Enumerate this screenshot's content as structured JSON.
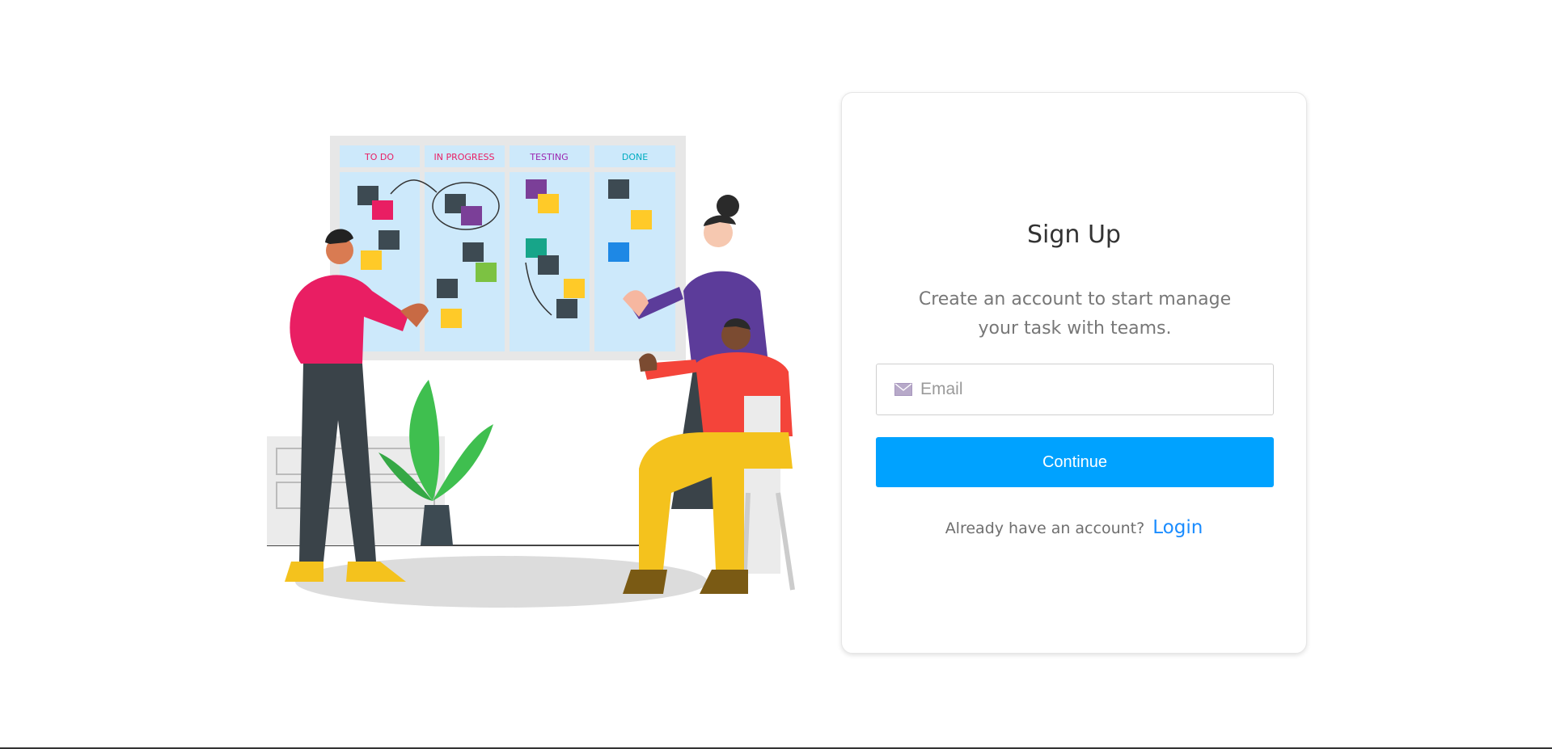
{
  "illustration": {
    "columns": [
      "TO DO",
      "IN PROGRESS",
      "TESTING",
      "DONE"
    ],
    "column_colors": [
      "#e91e63",
      "#e91e63",
      "#9c27b0",
      "#00acc1"
    ]
  },
  "signup": {
    "title": "Sign Up",
    "subtitle": "Create an account to start manage your task with teams.",
    "email_placeholder": "Email",
    "email_icon": "mail-icon",
    "continue_label": "Continue",
    "login_prompt": "Already have an account?",
    "login_label": "Login"
  },
  "colors": {
    "primary": "#00a2ff",
    "link": "#1a8cff",
    "title": "#333333",
    "muted": "#777777"
  }
}
